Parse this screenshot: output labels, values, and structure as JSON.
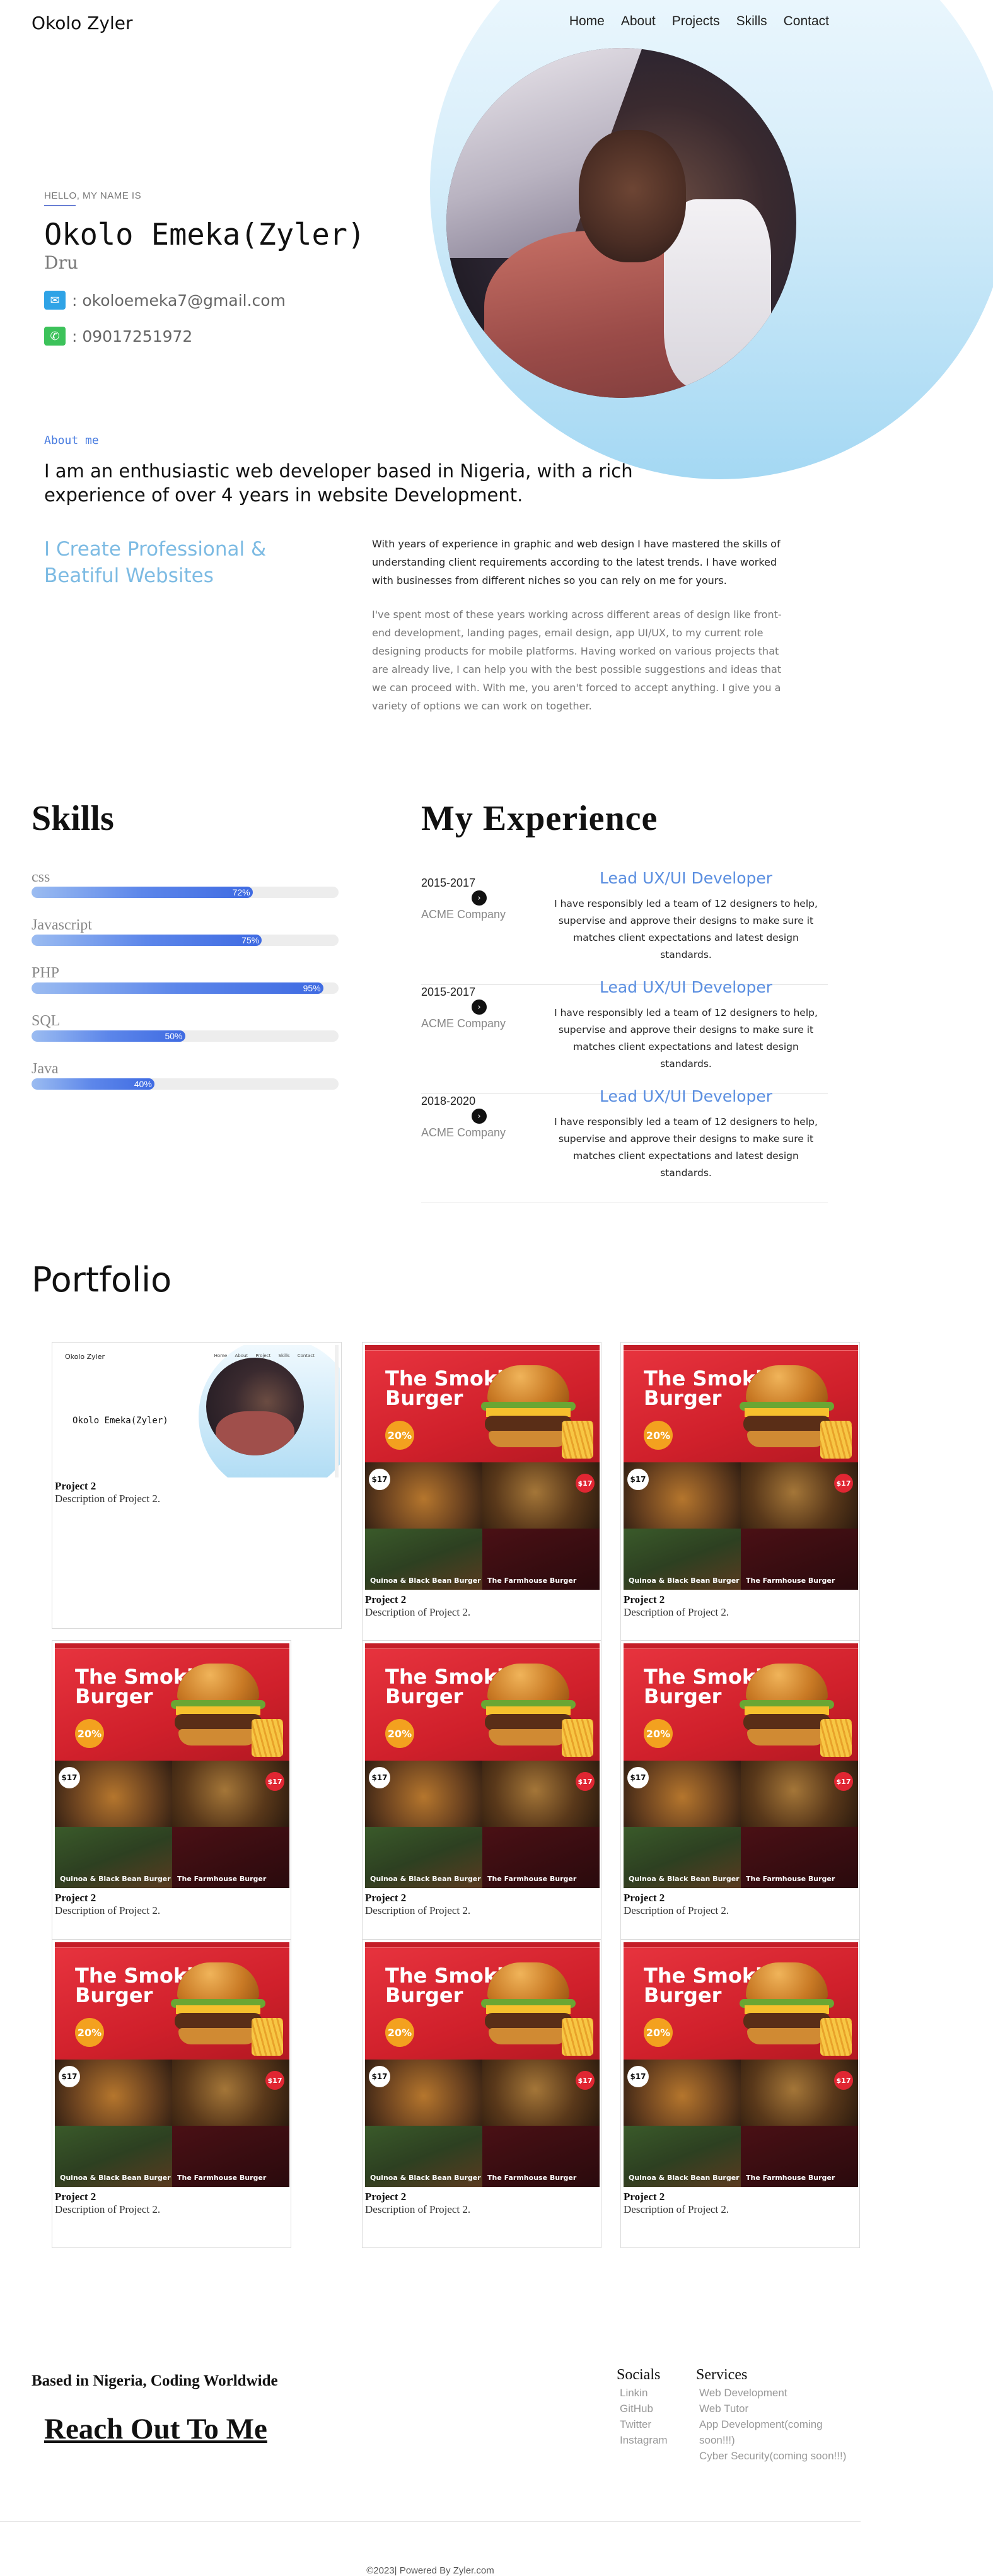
{
  "header": {
    "logo": "Okolo Zyler",
    "nav": [
      "Home",
      "About",
      "Projects",
      "Skills",
      "Contact"
    ]
  },
  "hero": {
    "greeting": "HELLO, MY NAME IS",
    "name": "Okolo Emeka(Zyler)",
    "alias": "Dru",
    "email": ": okoloemeka7@gmail.com",
    "phone": ": 09017251972"
  },
  "about": {
    "heading": "About me",
    "lead": "I am an enthusiastic web developer based in Nigeria, with a rich experience of over 4 years in website Development.",
    "tagline": "I Create Professional & Beatiful Websites",
    "paragraph1": "With years of experience in graphic and web design I have mastered the skills of understanding client requirements according to the latest trends. I have worked with businesses from different niches so you can rely on me for yours.",
    "paragraph2": "I've spent most of these years working across different areas of design like front-end development, landing pages, email design, app UI/UX, to my current role designing products for mobile platforms. Having worked on various projects that are already live, I can help you with the best possible suggestions and ideas that we can proceed with. With me, you aren't forced to accept anything. I give you a variety of options we can work on together."
  },
  "skills": {
    "heading": "Skills",
    "items": [
      {
        "name": "css",
        "percent": 72,
        "label": "72%"
      },
      {
        "name": "Javascript",
        "percent": 75,
        "label": "75%"
      },
      {
        "name": "PHP",
        "percent": 95,
        "label": "95%"
      },
      {
        "name": "SQL",
        "percent": 50,
        "label": "50%"
      },
      {
        "name": "Java",
        "percent": 40,
        "label": "40%"
      }
    ]
  },
  "experience": {
    "heading": "My Experience",
    "items": [
      {
        "years": "2015-2017",
        "company": "ACME Company",
        "role": "Lead UX/UI Developer",
        "description": "I have responsibly led a team of 12 designers to help, supervise and approve their designs to make sure it matches client expectations and latest design standards."
      },
      {
        "years": "2015-2017",
        "company": "ACME Company",
        "role": "Lead UX/UI Developer",
        "description": "I have responsibly led a team of 12 designers to help, supervise and approve their designs to make sure it matches client expectations and latest design standards."
      },
      {
        "years": "2018-2020",
        "company": "ACME Company",
        "role": "Lead UX/UI Developer",
        "description": "I have responsibly led a team of 12 designers to help, supervise and approve their designs to make sure it matches client expectations and latest design standards."
      }
    ]
  },
  "portfolio": {
    "heading": "Portfolio",
    "projects": [
      {
        "title": "Project 2",
        "description": "Description of Project 2.",
        "thumbnail": "portfolio-site"
      },
      {
        "title": "Project 2",
        "description": "Description of Project 2.",
        "thumbnail": "burger-site"
      },
      {
        "title": "Project 2",
        "description": "Description of Project 2.",
        "thumbnail": "burger-site"
      },
      {
        "title": "Project 2",
        "description": "Description of Project 2.",
        "thumbnail": "burger-site"
      },
      {
        "title": "Project 2",
        "description": "Description of Project 2.",
        "thumbnail": "burger-site"
      },
      {
        "title": "Project 2",
        "description": "Description of Project 2.",
        "thumbnail": "burger-site"
      },
      {
        "title": "Project 2",
        "description": "Description of Project 2.",
        "thumbnail": "burger-site"
      },
      {
        "title": "Project 2",
        "description": "Description of Project 2.",
        "thumbnail": "burger-site"
      },
      {
        "title": "Project 2",
        "description": "Description of Project 2.",
        "thumbnail": "burger-site"
      }
    ],
    "burger_thumb": {
      "title": "The Smokin Burger",
      "badge": "20%",
      "price": "$17",
      "caption_left": "Quinoa & Black Bean Burger",
      "caption_right": "The Farmhouse Burger"
    },
    "mini_thumb": {
      "logo": "Okolo Zyler",
      "nav": "Home About Project Skills Contact",
      "name": "Okolo Emeka(Zyler)"
    }
  },
  "footer": {
    "tagline": "Based in Nigeria, Coding Worldwide",
    "cta": "Reach Out To Me",
    "socials": {
      "heading": "Socials",
      "links": [
        "Linkin",
        "GitHub",
        "Twitter",
        "Instagram"
      ]
    },
    "services": {
      "heading": "Services",
      "items": [
        "Web Development",
        "Web Tutor",
        "App Development(coming soon!!!)",
        "Cyber Security(coming soon!!!)"
      ]
    },
    "copyright": "©2023| Powered By Zyler.com"
  },
  "colors": {
    "accent_blue": "#5a8ee0",
    "tagline_blue": "#7dbbe3",
    "skill_bar": "#3f6be2",
    "burger_red": "#d0202b"
  }
}
